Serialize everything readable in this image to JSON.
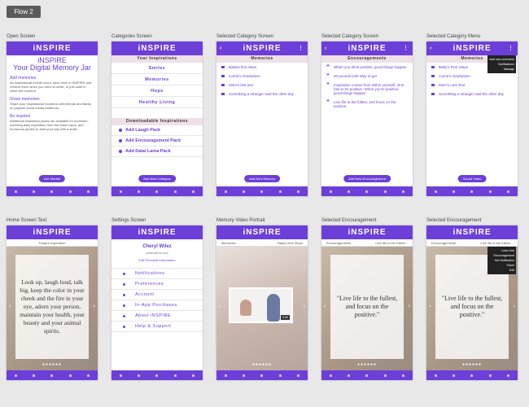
{
  "flow_label": "Flow 2",
  "brand": "iNSPIRE",
  "frames": {
    "open": {
      "label": "Open Screen",
      "appbar": "iNSPIRE",
      "subtitle": "iNSPIRE\nYour Digital Memory Jar",
      "sections": [
        {
          "title": "Add memories",
          "text": "As inspirational events occur, save them in iNSPIRE and retrieve them when you need to smile, or just want to relive the moment."
        },
        {
          "title": "Share memories",
          "text": "Share your inspirational moments with friends and family on popular social media platforms."
        },
        {
          "title": "Be inspired",
          "text": "Additional inspiration packs are available for purchase, including daily inspiration from the Dalai Lama, and humorous quotes to start your day with a smile."
        }
      ],
      "button": "Get Started"
    },
    "categories": {
      "label": "Categories Screen",
      "appbar": "iNSPIRE",
      "header": "Your Inspirations",
      "items": [
        "Smiles",
        "Memories",
        "Hope",
        "Healthy Living"
      ],
      "download_header": "Downloadable Inspirations",
      "downloads": [
        "Add Laugh Pack",
        "Add Encouragement Pack",
        "Add Dalai Lama Pack"
      ],
      "button": "Add New Category"
    },
    "selected_category": {
      "label": "Selected Category Screen",
      "appbar": "iNSPIRE",
      "header": "Memories",
      "items": [
        "Babies first steps",
        "Carrie's Graduation",
        "Mom's last text",
        "Something a stranger said the other day"
      ],
      "button": "Add New Memory"
    },
    "selected_category_2": {
      "label": "Selected Category Screen",
      "appbar": "iNSPIRE",
      "header": "Encouragements",
      "items": [
        "When you think positive, good things happen.",
        "20 pounds lost! Way to go!",
        "Inspiration comes from within yourself. One has to be positive. When you're positive, good things happen.",
        "Live life to the fullest, and focus on the positive."
      ],
      "button": "Add New Encouragement"
    },
    "category_menu": {
      "label": "Selected Category Menu",
      "appbar": "iNSPIRE",
      "header": "Memories",
      "items": [
        "Baby's First Steps",
        "Carrie's Graduation",
        "Mom's Last Text",
        "Something a stranger said the other day"
      ],
      "menu": [
        "Add new memories",
        "Notifications",
        "Manage"
      ],
      "button": "Sound Video"
    },
    "home_text": {
      "label": "Home Screen Text",
      "appbar": "iNSPIRE",
      "topbar_left": "Today's Inspiration",
      "quote": "Look up, laugh loud, talk big, keep the color in your cheek and the fire in your eye, adorn your person, maintain your health, your beauty and your animal spirits."
    },
    "settings": {
      "label": "Settings Screen",
      "appbar": "iNSPIRE",
      "name": "Cheryl Wilez",
      "email": "cwilez@me.com",
      "edit_link": "Edit Personal Information",
      "items": [
        "Notifications",
        "Preferences",
        "Account",
        "In-App Purchases",
        "About iNSPIRE",
        "Help & Support"
      ]
    },
    "video": {
      "label": "Memory Video Portrait",
      "appbar": "iNSPIRE",
      "topbar_left": "Memories",
      "topbar_right": "Baby's first Steps",
      "duration": "0:30"
    },
    "encouragement": {
      "label": "Selected Encouragement",
      "appbar": "iNSPIRE",
      "topbar_left": "Encouragements",
      "topbar_right": "Live life to the fullest...",
      "quote": "\"Live life to the fullest, and focus on the positive.\""
    },
    "encouragement_menu": {
      "label": "Selected Encouragement",
      "appbar": "iNSPIRE",
      "topbar_left": "Encouragements",
      "topbar_right": "Live life to the fullest...",
      "quote": "\"Live life to the fullest, and focus on the positive.\"",
      "menu": [
        "Learn this Encouragement",
        "Set Notification",
        "Share",
        "Edit"
      ]
    }
  },
  "colors": {
    "accent": "#6c3fd9",
    "section_bg": "#efe0e8",
    "page_bg": "#e8e8e8"
  }
}
